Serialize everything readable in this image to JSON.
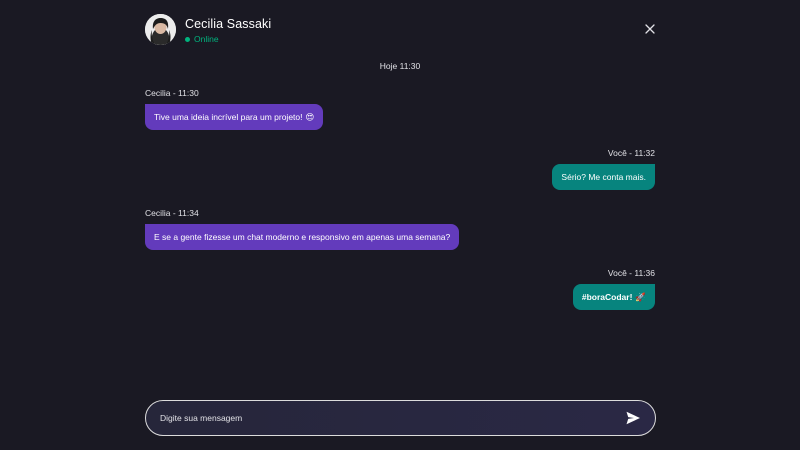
{
  "header": {
    "contact_name": "Cecilia Sassaki",
    "status": "Online",
    "avatar_icon": "user-avatar",
    "close_icon": "close-icon"
  },
  "chat": {
    "date_separator": "Hoje 11:30",
    "messages": [
      {
        "direction": "incoming",
        "meta": "Cecilia - 11:30",
        "text": "Tive uma ideia incrível para um projeto!",
        "emoji": "😍"
      },
      {
        "direction": "outgoing",
        "meta": "Você - 11:32",
        "text": "Sério? Me conta mais."
      },
      {
        "direction": "incoming",
        "meta": "Cecilia - 11:34",
        "text": "E se a gente fizesse um chat moderno e responsivo em apenas uma semana?"
      },
      {
        "direction": "outgoing",
        "meta": "Você - 11:36",
        "text": "#boraCodar!",
        "emoji": "🚀"
      }
    ]
  },
  "composer": {
    "placeholder": "Digite sua mensagem",
    "send_icon": "send-icon"
  },
  "colors": {
    "background": "#1a1923",
    "incoming_bubble": "#633bbc",
    "outgoing_bubble": "#07847e",
    "online": "#00b37e"
  }
}
